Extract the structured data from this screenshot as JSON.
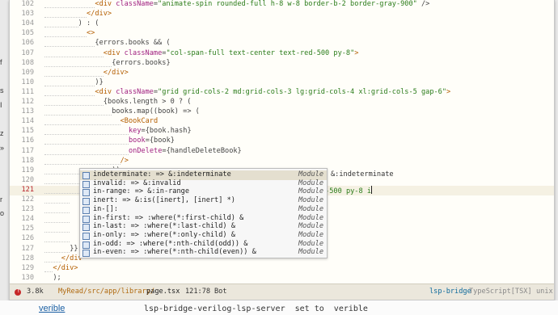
{
  "left_fragments": [
    "f",
    "s",
    "I",
    "z",
    "»",
    "r",
    "o"
  ],
  "editor": {
    "lines": [
      {
        "num": "102",
        "indent": 12,
        "segs": [
          [
            "tag",
            "<div "
          ],
          [
            "attr",
            "className"
          ],
          [
            "pun",
            "="
          ],
          [
            "str",
            "\"animate-spin rounded-full h-8 w-8 border-b-2 border-gray-900\""
          ],
          [
            "pun",
            " />"
          ]
        ]
      },
      {
        "num": "103",
        "indent": 10,
        "segs": [
          [
            "tag",
            "</div>"
          ]
        ]
      },
      {
        "num": "104",
        "indent": 8,
        "segs": [
          [
            "pun",
            ") : ("
          ]
        ]
      },
      {
        "num": "105",
        "indent": 10,
        "segs": [
          [
            "tag",
            "<>"
          ]
        ]
      },
      {
        "num": "106",
        "indent": 12,
        "segs": [
          [
            "pun",
            "{errors.books && ("
          ]
        ]
      },
      {
        "num": "107",
        "indent": 14,
        "segs": [
          [
            "tag",
            "<div "
          ],
          [
            "attr",
            "className"
          ],
          [
            "pun",
            "="
          ],
          [
            "str",
            "\"col-span-full text-center text-red-500 py-8\""
          ],
          [
            "tag",
            ">"
          ]
        ]
      },
      {
        "num": "108",
        "indent": 16,
        "segs": [
          [
            "pun",
            "{errors.books}"
          ]
        ]
      },
      {
        "num": "109",
        "indent": 14,
        "segs": [
          [
            "tag",
            "</div>"
          ]
        ]
      },
      {
        "num": "110",
        "indent": 12,
        "segs": [
          [
            "pun",
            ")}"
          ]
        ]
      },
      {
        "num": "111",
        "indent": 12,
        "segs": [
          [
            "tag",
            "<div "
          ],
          [
            "attr",
            "className"
          ],
          [
            "pun",
            "="
          ],
          [
            "str",
            "\"grid grid-cols-2 md:grid-cols-3 lg:grid-cols-4 xl:grid-cols-5 gap-6\""
          ],
          [
            "tag",
            ">"
          ]
        ]
      },
      {
        "num": "112",
        "indent": 14,
        "segs": [
          [
            "pun",
            "{books.length > 0 ? ("
          ]
        ]
      },
      {
        "num": "113",
        "indent": 16,
        "segs": [
          [
            "pun",
            "books.map((book) => ("
          ]
        ]
      },
      {
        "num": "114",
        "indent": 18,
        "segs": [
          [
            "tag",
            "<BookCard"
          ]
        ]
      },
      {
        "num": "115",
        "indent": 20,
        "segs": [
          [
            "attr",
            "key"
          ],
          [
            "pun",
            "={book.hash}"
          ]
        ]
      },
      {
        "num": "116",
        "indent": 20,
        "segs": [
          [
            "attr",
            "book"
          ],
          [
            "pun",
            "={book}"
          ]
        ]
      },
      {
        "num": "117",
        "indent": 20,
        "segs": [
          [
            "attr",
            "onDelete"
          ],
          [
            "pun",
            "={handleDeleteBook}"
          ]
        ]
      },
      {
        "num": "118",
        "indent": 18,
        "segs": [
          [
            "tag",
            "/>"
          ]
        ]
      },
      {
        "num": "119",
        "indent": 16,
        "segs": [
          [
            "pun",
            "))"
          ]
        ]
      },
      {
        "num": "120",
        "indent": 14,
        "segs": [
          [
            "pun",
            ") : ("
          ]
        ]
      },
      {
        "num": "121",
        "indent": 16,
        "current": true,
        "segs": [
          [
            "tag",
            "<div "
          ],
          [
            "attr",
            "className"
          ],
          [
            "pun",
            "="
          ],
          [
            "str",
            "\"col-span-full text-center text-gray-500 py-8 i"
          ]
        ]
      },
      {
        "num": "122",
        "indent": 6,
        "segs": []
      },
      {
        "num": "123",
        "indent": 6,
        "segs": []
      },
      {
        "num": "124",
        "indent": 6,
        "segs": []
      },
      {
        "num": "125",
        "indent": 6,
        "segs": []
      },
      {
        "num": "126",
        "indent": 6,
        "segs": []
      },
      {
        "num": "127",
        "indent": 6,
        "segs": [
          [
            "pun",
            "}}"
          ]
        ]
      },
      {
        "num": "128",
        "indent": 4,
        "segs": [
          [
            "tag",
            "</div"
          ]
        ]
      },
      {
        "num": "129",
        "indent": 2,
        "segs": [
          [
            "tag",
            "</div>"
          ]
        ]
      },
      {
        "num": "130",
        "indent": 0,
        "segs": [
          [
            "pun",
            "  );"
          ]
        ]
      },
      {
        "num": "131",
        "indent": 0,
        "segs": [
          [
            "pun",
            "}"
          ]
        ]
      }
    ]
  },
  "completion": {
    "items": [
      {
        "label": "indeterminate: => &:indeterminate",
        "kind": "Module",
        "selected": true
      },
      {
        "label": "invalid: => &:invalid",
        "kind": "Module"
      },
      {
        "label": "in-range: => &:in-range",
        "kind": "Module"
      },
      {
        "label": "inert: => &:is([inert], [inert] *)",
        "kind": "Module"
      },
      {
        "label": "in-[]:",
        "kind": "Module"
      },
      {
        "label": "in-first: => :where(*:first-child) &",
        "kind": "Module"
      },
      {
        "label": "in-last: => :where(*:last-child) &",
        "kind": "Module"
      },
      {
        "label": "in-only: => :where(*:only-child) &",
        "kind": "Module"
      },
      {
        "label": "in-odd: => :where(*:nth-child(odd)) &",
        "kind": "Module"
      },
      {
        "label": "in-even: => :where(*:nth-child(even)) &",
        "kind": "Module"
      }
    ],
    "preview": "&:indeterminate"
  },
  "modeline": {
    "error_count": "!",
    "file_size": "3.8k",
    "path": "MyRead/src/app/library/",
    "file_name": "page.tsx",
    "cursor_position": "121:78",
    "scroll_position": "Bot",
    "lsp": "lsp-bridge",
    "mode": "TypeScript[TSX]",
    "encoding": "unix"
  },
  "bottom": {
    "link_text": "verible",
    "text": "lsp-bridge-verilog-lsp-server  set to  verible"
  },
  "colors": {
    "accent_error": "#c62828",
    "path": "#b06a10",
    "lsp": "#0e6a9b",
    "selection": "#e4dfcf"
  }
}
